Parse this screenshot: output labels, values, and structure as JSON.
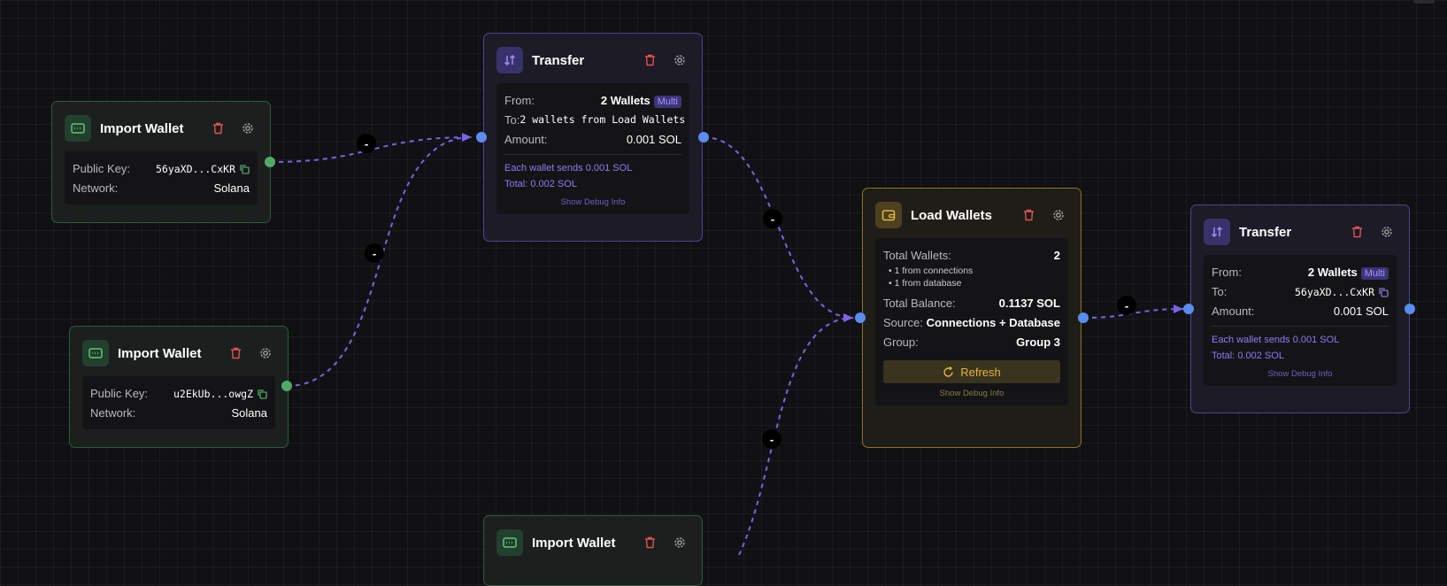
{
  "nodes": {
    "import1": {
      "title": "Import Wallet",
      "public_key_label": "Public Key:",
      "public_key": "56yaXD...CxKR",
      "network_label": "Network:",
      "network": "Solana"
    },
    "import2": {
      "title": "Import Wallet",
      "public_key_label": "Public Key:",
      "public_key": "u2EkUb...owgZ",
      "network_label": "Network:",
      "network": "Solana"
    },
    "import3": {
      "title": "Import Wallet"
    },
    "transfer1": {
      "title": "Transfer",
      "from_label": "From:",
      "from": "2 Wallets",
      "from_badge": "Multi",
      "to_label": "To:",
      "to": "2 wallets from Load Wallets",
      "amount_label": "Amount:",
      "amount": "0.001 SOL",
      "info_line1": "Each wallet sends 0.001 SOL",
      "info_line2": "Total: 0.002 SOL",
      "debug": "Show Debug Info"
    },
    "load": {
      "title": "Load Wallets",
      "total_wallets_label": "Total Wallets:",
      "total_wallets": "2",
      "sub1": "• 1 from connections",
      "sub2": "• 1 from database",
      "total_balance_label": "Total Balance:",
      "total_balance": "0.1137 SOL",
      "source_label": "Source:",
      "source": "Connections + Database",
      "group_label": "Group:",
      "group": "Group 3",
      "refresh": "Refresh",
      "debug": "Show Debug Info"
    },
    "transfer2": {
      "title": "Transfer",
      "from_label": "From:",
      "from": "2 Wallets",
      "from_badge": "Multi",
      "to_label": "To:",
      "to": "56yaXD...CxKR",
      "amount_label": "Amount:",
      "amount": "0.001 SOL",
      "info_line1": "Each wallet sends 0.001 SOL",
      "info_line2": "Total: 0.002 SOL",
      "debug": "Show Debug Info"
    }
  },
  "edge_labels": [
    "-",
    "-",
    "-",
    "-",
    "-"
  ],
  "colors": {
    "canvas_bg": "#111113",
    "edge": "#7c62ea",
    "handle_blue": "#5b8cf0",
    "handle_green": "#52a86b",
    "delete_red": "#e05252",
    "accent_purple": "#9c8cf5",
    "accent_gold": "#e2b640",
    "accent_green": "#5fc27c"
  },
  "icons": {
    "import": "wallet-card-icon",
    "transfer": "transfer-arrows-icon",
    "load": "wallet-icon",
    "delete": "trash-icon",
    "settings": "gear-icon",
    "copy": "copy-icon",
    "refresh": "refresh-icon"
  }
}
